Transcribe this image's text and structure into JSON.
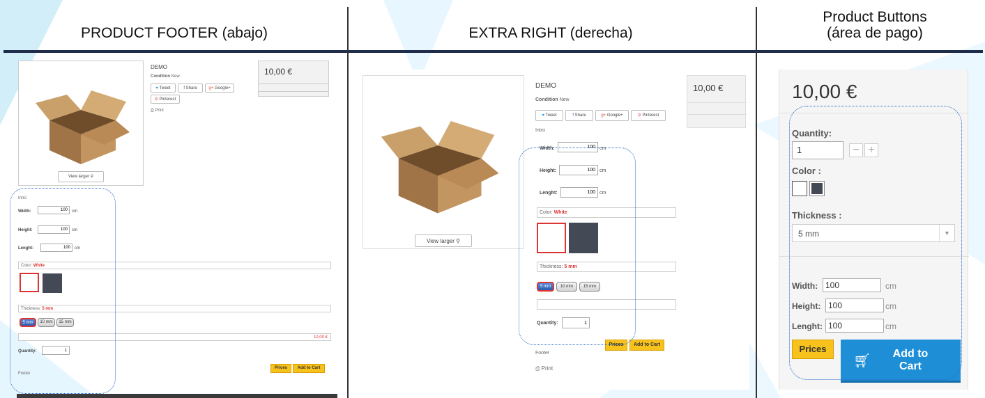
{
  "headers": {
    "footer": "PRODUCT FOOTER (abajo)",
    "extra_right": "EXTRA RIGHT (derecha)",
    "buttons_line1": "Product Buttons",
    "buttons_line2": "(área de pago)"
  },
  "product": {
    "name": "DEMO",
    "condition_label": "Condition",
    "condition_value": "New",
    "price": "10,00 €",
    "view_larger": "View larger",
    "print": "Print",
    "intro": "Intro",
    "footer": "Footer"
  },
  "social": {
    "tweet": "Tweet",
    "share": "Share",
    "google": "Google+",
    "pinterest": "Pinterest"
  },
  "dimensions": {
    "width_label": "Width:",
    "height_label": "Height:",
    "lenght_label": "Lenght:",
    "width_value": "100",
    "height_value": "100",
    "lenght_value": "100",
    "unit": "cm"
  },
  "color": {
    "label": "Color:",
    "label_spaced": "Color :",
    "value": "White"
  },
  "thickness": {
    "label": "Thickness:",
    "label_spaced": "Thickness :",
    "value": "5 mm",
    "options": [
      "5 mm",
      "10 mm",
      "15 mm"
    ]
  },
  "quantity": {
    "label": "Quantity:",
    "value": "1"
  },
  "buttons": {
    "prices": "Prices",
    "add_to_cart": "Add to Cart",
    "add_line1": "Add to",
    "add_line2": "Cart"
  },
  "colors": {
    "rule": "#1f2d4a",
    "yellow": "#f8c21c",
    "cart_blue": "#1e8fd6",
    "swatch_dark": "#444a55",
    "accent_red": "#d33333",
    "dashed": "#2a6bc9"
  }
}
